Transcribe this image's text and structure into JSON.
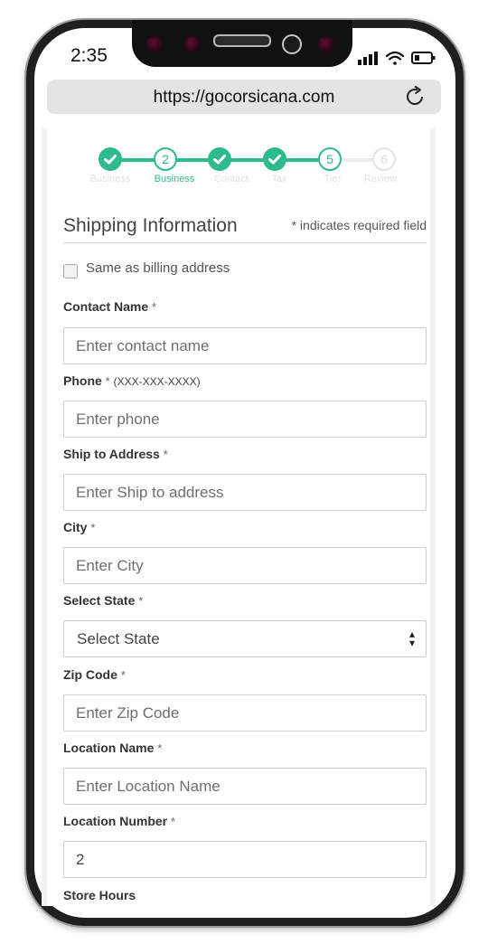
{
  "status_bar": {
    "time": "2:35"
  },
  "browser": {
    "url": "https://gocorsicana.com"
  },
  "stepper": {
    "steps": [
      {
        "number": "1",
        "label": "Business",
        "state": "done"
      },
      {
        "number": "2",
        "label": "Business",
        "state": "current"
      },
      {
        "number": "3",
        "label": "Contact",
        "state": "done"
      },
      {
        "number": "4",
        "label": "Tax",
        "state": "done"
      },
      {
        "number": "5",
        "label": "Tier",
        "state": "current"
      },
      {
        "number": "6",
        "label": "Review",
        "state": "future"
      }
    ],
    "accent_color": "#2dba8d"
  },
  "form": {
    "title": "Shipping Information",
    "required_note": "* indicates required field",
    "same_as_billing_label": "Same as billing address",
    "fields": {
      "contact_name": {
        "label": "Contact Name",
        "star": "*",
        "placeholder": "Enter contact name"
      },
      "phone": {
        "label": "Phone",
        "star": "*",
        "hint": "(XXX-XXX-XXXX)",
        "placeholder": "Enter phone"
      },
      "ship_address": {
        "label": "Ship to Address",
        "star": "*",
        "placeholder": "Enter Ship to address"
      },
      "city": {
        "label": "City",
        "star": "*",
        "placeholder": "Enter City"
      },
      "state": {
        "label": "Select State",
        "star": "*",
        "selected": "Select State"
      },
      "zip": {
        "label": "Zip Code",
        "star": "*",
        "placeholder": "Enter Zip Code"
      },
      "location_name": {
        "label": "Location Name",
        "star": "*",
        "placeholder": "Enter Location Name"
      },
      "location_number": {
        "label": "Location Number",
        "star": "*",
        "value": "2"
      },
      "store_hours": {
        "label": "Store Hours"
      }
    }
  }
}
